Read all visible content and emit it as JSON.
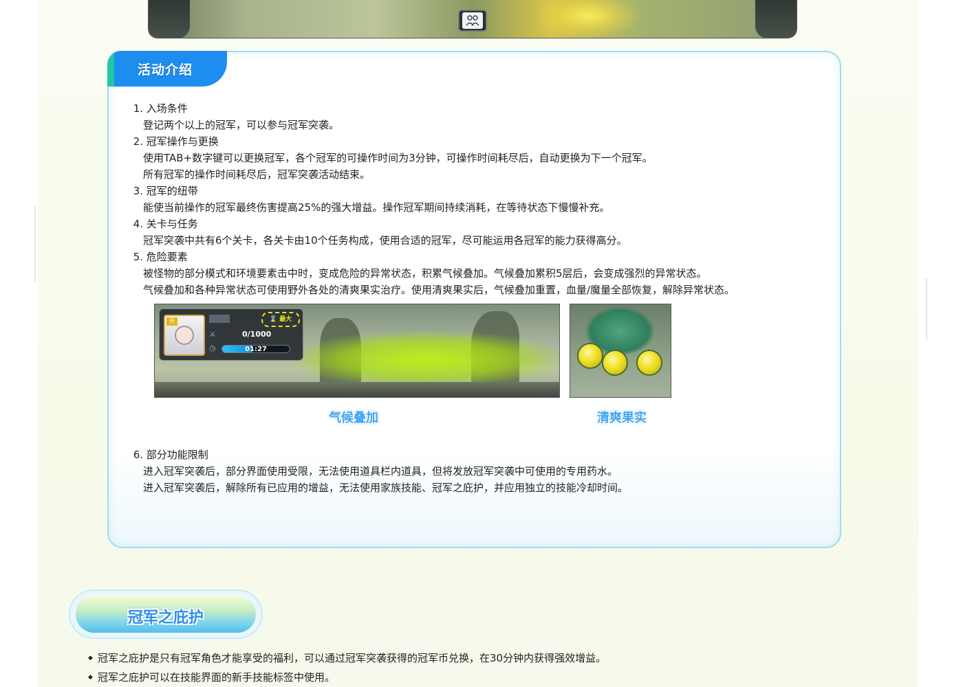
{
  "banner": {
    "switch_icon": "party-switch-icon"
  },
  "activity": {
    "tab_title": "活动介绍",
    "items": [
      {
        "num": "1.",
        "title": "入场条件",
        "lines": [
          "登记两个以上的冠军，可以参与冠军突袭。"
        ]
      },
      {
        "num": "2.",
        "title": "冠军操作与更换",
        "lines": [
          "使用TAB+数字键可以更换冠军，各个冠军的可操作时间为3分钟，可操作时间耗尽后，自动更换为下一个冠军。",
          "所有冠军的操作时间耗尽后，冠军突袭活动结束。"
        ]
      },
      {
        "num": "3.",
        "title": "冠军的纽带",
        "lines": [
          "能使当前操作的冠军最终伤害提高25%的强大增益。操作冠军期间持续消耗，在等待状态下慢慢补充。"
        ]
      },
      {
        "num": "4.",
        "title": "关卡与任务",
        "lines": [
          "冠军突袭中共有6个关卡，各关卡由10个任务构成，使用合适的冠军，尽可能运用各冠军的能力获得高分。"
        ]
      },
      {
        "num": "5.",
        "title": "危险要素",
        "lines": [
          "被怪物的部分模式和环境要素击中时，变成危险的异常状态，积累气候叠加。气候叠加累积5层后，会变成强烈的异常状态。",
          "气候叠加和各种异常状态可使用野外各处的清爽果实治疗。使用清爽果实后，气候叠加重置，血量/魔量全部恢复，解除异常状态。"
        ]
      }
    ],
    "images": {
      "main_caption": "气候叠加",
      "fruit_caption": "清爽果实",
      "hud": {
        "badge": "开",
        "timer_label": "⌛ 最大",
        "score": "0/1000",
        "time": "01:27",
        "time_progress": 0.45
      }
    },
    "item6": {
      "num": "6.",
      "title": "部分功能限制",
      "lines": [
        "进入冠军突袭后，部分界面使用受限，无法使用道具栏内道具，但将发放冠军突袭中可使用的专用药水。",
        "进入冠军突袭后，解除所有已应用的增益，无法使用家族技能、冠军之庇护，并应用独立的技能冷却时间。"
      ]
    }
  },
  "protection": {
    "title": "冠军之庇护",
    "bullets": [
      "冠军之庇护是只有冠军角色才能享受的福利，可以通过冠军突袭获得的冠军币兑换，在30分钟内获得强效增益。",
      "冠军之庇护可以在技能界面的新手技能标签中使用。"
    ]
  },
  "colors": {
    "tab_blue": "#1d8df0",
    "tab_green": "#22c8a4",
    "panel_border": "#9edcf3",
    "caption_blue": "#3ea5f0"
  }
}
